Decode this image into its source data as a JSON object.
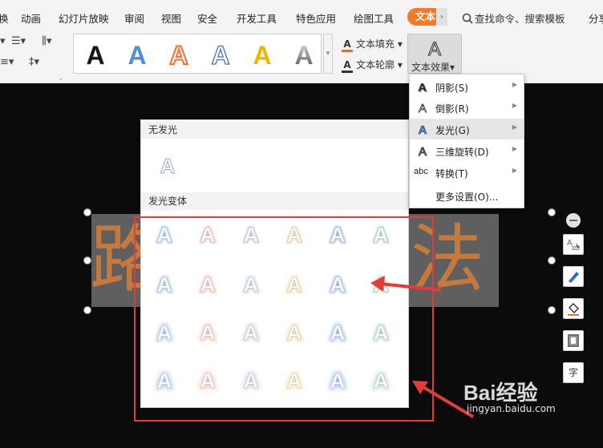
{
  "tabs": [
    {
      "label": "换"
    },
    {
      "label": "动画"
    },
    {
      "label": "幻灯片放映"
    },
    {
      "label": "审阅"
    },
    {
      "label": "视图"
    },
    {
      "label": "安全"
    },
    {
      "label": "开发工具"
    },
    {
      "label": "特色应用"
    },
    {
      "label": "绘图工具"
    },
    {
      "label": "文本"
    },
    {
      "label": "分享"
    }
  ],
  "search": {
    "label": "查找命令、搜索模板"
  },
  "ribbon": {
    "text_fill": "文本填充",
    "text_outline": "文本轮廓",
    "text_effect": "文本效果",
    "effect_icon_letter": "A"
  },
  "effect_menu": {
    "items": [
      {
        "label": "阴影(S)",
        "icon": "shadow-icon"
      },
      {
        "label": "倒影(R)",
        "icon": "reflection-icon"
      },
      {
        "label": "发光(G)",
        "icon": "glow-icon"
      },
      {
        "label": "三维旋转(D)",
        "icon": "3d-rotation-icon"
      },
      {
        "label": "转换(T)",
        "icon": "transform-icon",
        "icon_text": "abc"
      },
      {
        "label": "更多设置(O)..."
      }
    ],
    "active_index": 2
  },
  "glow_panel": {
    "no_glow_title": "无发光",
    "variants_title": "发光变体",
    "letter": "A",
    "glow_colors": [
      "#5b8fd6",
      "#f08a4b",
      "#a5a5a5",
      "#f5c431",
      "#4a74c9",
      "#7ab55c"
    ]
  },
  "slide": {
    "text_left": "路",
    "text_right": "法",
    "text_color": "#c6793c"
  },
  "watermark": {
    "logo": "Bai经验",
    "url": "jingyan.baidu.com"
  },
  "colors": {
    "accent_orange": "#f07a2a",
    "annotation_red": "#e53a3a"
  }
}
